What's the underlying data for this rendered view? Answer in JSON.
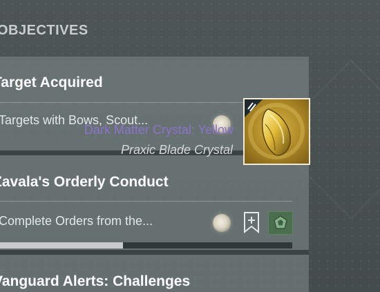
{
  "section": {
    "title": "OBJECTIVES"
  },
  "quests": [
    {
      "title": "Target Acquired",
      "description": "Targets with Bows, Scout..."
    },
    {
      "title": "Zavala's Orderly Conduct",
      "description": "Complete Orders from the...",
      "progress": 0.42
    },
    {
      "title": "Vanguard Alerts: Challenges"
    }
  ],
  "tooltip": {
    "item_name": "Dark Matter Crystal: Yellow",
    "item_type": "Praxic Blade Crystal"
  },
  "icons": {
    "reward": "engram-orb-icon",
    "bookmark": "bookmark-plus-icon",
    "quest": "vanguard-quest-icon",
    "item": "yellow-crystal-icon"
  },
  "colors": {
    "item_name": "#8b73c9",
    "progress_fill": "#c7cbcb",
    "quest_icon_bg": "#4b6e4f"
  }
}
